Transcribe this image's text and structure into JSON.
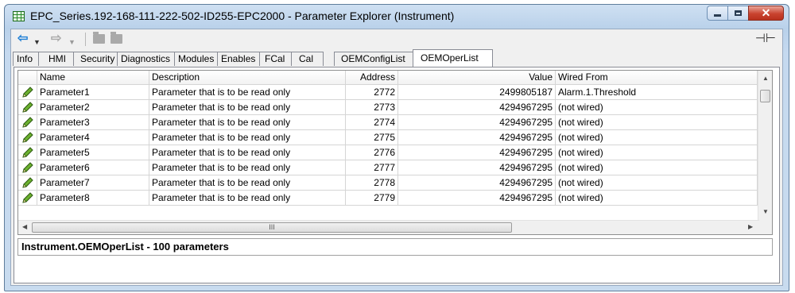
{
  "window": {
    "title": "EPC_Series.192-168-111-222-502-ID255-EPC2000 - Parameter Explorer (Instrument)",
    "close_glyph": "✕"
  },
  "toolbar": {
    "back_glyph": "⇦",
    "forward_glyph": "⇨",
    "dropdown_glyph": "▼",
    "pin_glyph": "⊣⊢"
  },
  "tabs": [
    {
      "label": "Info"
    },
    {
      "label": "HMI"
    },
    {
      "label": "Security"
    },
    {
      "label": "Diagnostics"
    },
    {
      "label": "Modules"
    },
    {
      "label": "Enables"
    },
    {
      "label": "FCal"
    },
    {
      "label": "Cal"
    },
    {
      "label": "OEMConfigList"
    },
    {
      "label": "OEMOperList",
      "active": true
    }
  ],
  "table": {
    "columns": [
      "Name",
      "Description",
      "Address",
      "Value",
      "Wired From"
    ],
    "rows": [
      {
        "name": "Parameter1",
        "description": "Parameter that is to be read only",
        "address": "2772",
        "value": "2499805187",
        "wired_from": "Alarm.1.Threshold"
      },
      {
        "name": "Parameter2",
        "description": "Parameter that is to be read only",
        "address": "2773",
        "value": "4294967295",
        "wired_from": "(not wired)"
      },
      {
        "name": "Parameter3",
        "description": "Parameter that is to be read only",
        "address": "2774",
        "value": "4294967295",
        "wired_from": "(not wired)"
      },
      {
        "name": "Parameter4",
        "description": "Parameter that is to be read only",
        "address": "2775",
        "value": "4294967295",
        "wired_from": "(not wired)"
      },
      {
        "name": "Parameter5",
        "description": "Parameter that is to be read only",
        "address": "2776",
        "value": "4294967295",
        "wired_from": "(not wired)"
      },
      {
        "name": "Parameter6",
        "description": "Parameter that is to be read only",
        "address": "2777",
        "value": "4294967295",
        "wired_from": "(not wired)"
      },
      {
        "name": "Parameter7",
        "description": "Parameter that is to be read only",
        "address": "2778",
        "value": "4294967295",
        "wired_from": "(not wired)"
      },
      {
        "name": "Parameter8",
        "description": "Parameter that is to be read only",
        "address": "2779",
        "value": "4294967295",
        "wired_from": "(not wired)"
      }
    ],
    "row_icon": "pencil-icon",
    "scrollbar_grip": "III"
  },
  "status": {
    "text": "Instrument.OEMOperList  -  100 parameters"
  },
  "colors": {
    "title_gradient_top": "#cfe0f2",
    "close_button": "#c9432f",
    "back_arrow": "#1e7fd6",
    "pencil": "#5a9a2a"
  }
}
